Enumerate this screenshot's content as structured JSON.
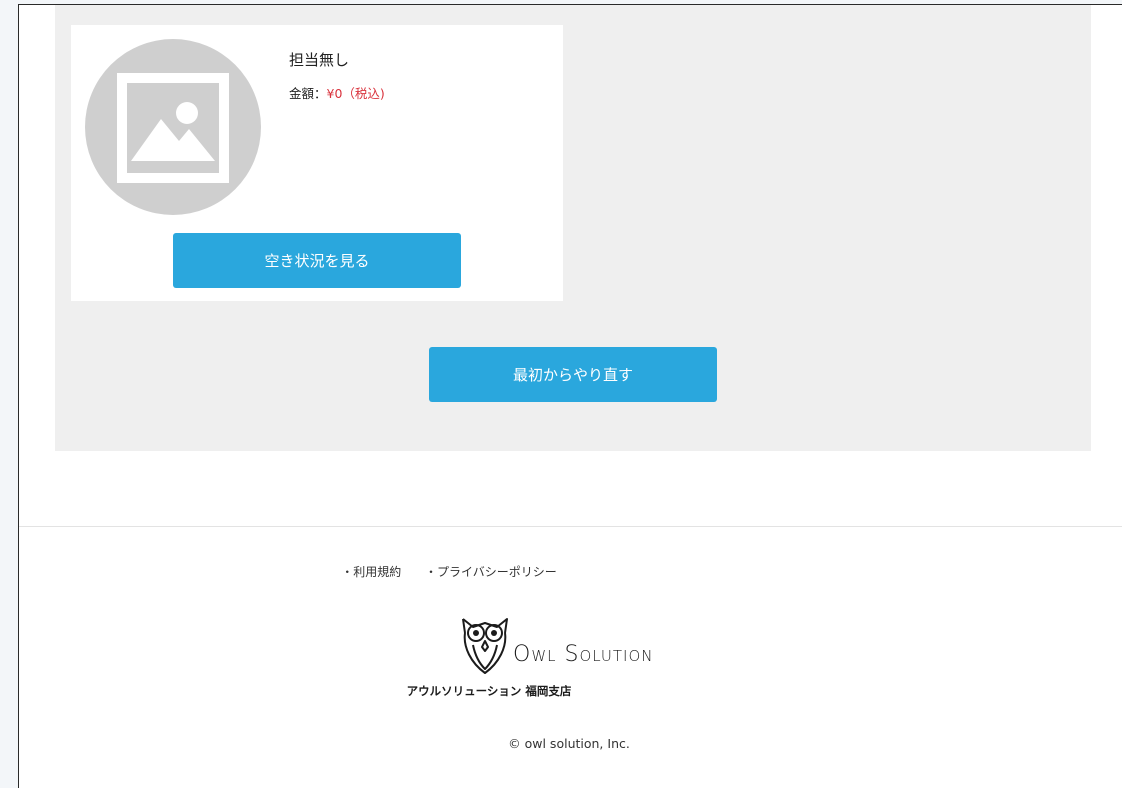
{
  "staff_card": {
    "name": "担当無し",
    "price_label": "金額：",
    "price_value": "¥0（税込)",
    "availability_button": "空き状況を見る"
  },
  "restart_button": "最初からやり直す",
  "footer": {
    "links": [
      "・利用規約",
      "・プライバシーポリシー"
    ],
    "brand": "Owl Solution",
    "branch": "アウルソリューション 福岡支店",
    "copyright": "© owl solution, Inc."
  },
  "icons": {
    "placeholder": "image-placeholder-icon",
    "logo": "owl-logo-icon"
  },
  "colors": {
    "accent": "#2aa7dd",
    "price": "#d9323c",
    "panel": "#efefef"
  }
}
